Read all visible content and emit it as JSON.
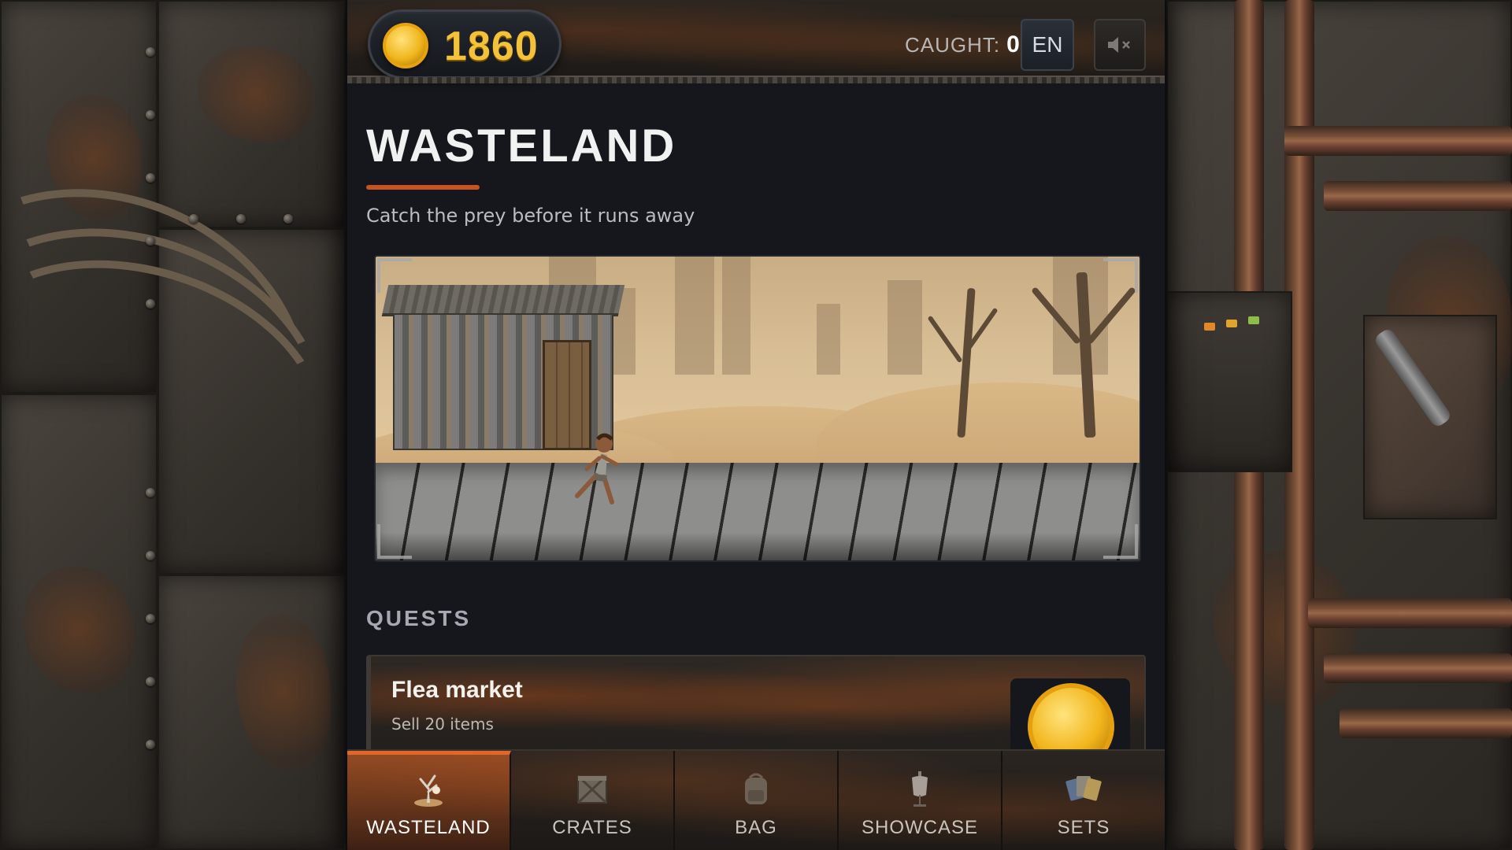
{
  "header": {
    "coins": "1860",
    "caught_label": "CAUGHT:",
    "caught_value": "0",
    "language": "EN",
    "sound_icon": "speaker-muted-icon"
  },
  "page": {
    "title": "WASTELAND",
    "subtitle": "Catch the prey before it runs away"
  },
  "scene": {
    "description_icon": "wasteland-scene"
  },
  "quests": {
    "heading": "QUESTS",
    "items": [
      {
        "title": "Flea market",
        "description": "Sell 20 items",
        "reward_icon": "gold-coin-icon"
      }
    ]
  },
  "nav": {
    "items": [
      {
        "label": "WASTELAND",
        "icon": "dead-tree-icon",
        "active": true
      },
      {
        "label": "CRATES",
        "icon": "crate-icon",
        "active": false
      },
      {
        "label": "BAG",
        "icon": "backpack-icon",
        "active": false
      },
      {
        "label": "SHOWCASE",
        "icon": "mannequin-icon",
        "active": false
      },
      {
        "label": "SETS",
        "icon": "cards-icon",
        "active": false
      }
    ]
  },
  "colors": {
    "accent": "#e0662a",
    "gold": "#f3c23a",
    "background": "#15171c"
  }
}
